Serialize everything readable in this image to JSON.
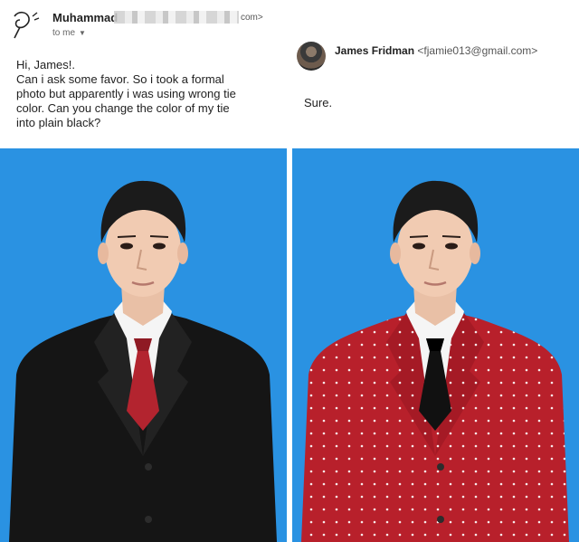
{
  "left_email": {
    "sender_name": "Muhammad",
    "sender_domain": "com>",
    "recipient_label": "to me",
    "greeting": "Hi, James!.",
    "body_lines": [
      "Can i ask some favor. So i took a formal",
      "photo but apparently i was using wrong tie",
      "color. Can you change the color of my tie",
      "into plain black?"
    ]
  },
  "right_email": {
    "sender_name": "James Fridman",
    "sender_email": "<fjamie013@gmail.com>",
    "reply": "Sure."
  },
  "photos": {
    "background_color": "#2a92e2",
    "original": {
      "suit_color": "#151515",
      "tie_color": "#b3242f"
    },
    "edited": {
      "suit_color": "#b8202b",
      "tie_color": "#111111",
      "pattern": "white-polka-dots"
    }
  }
}
